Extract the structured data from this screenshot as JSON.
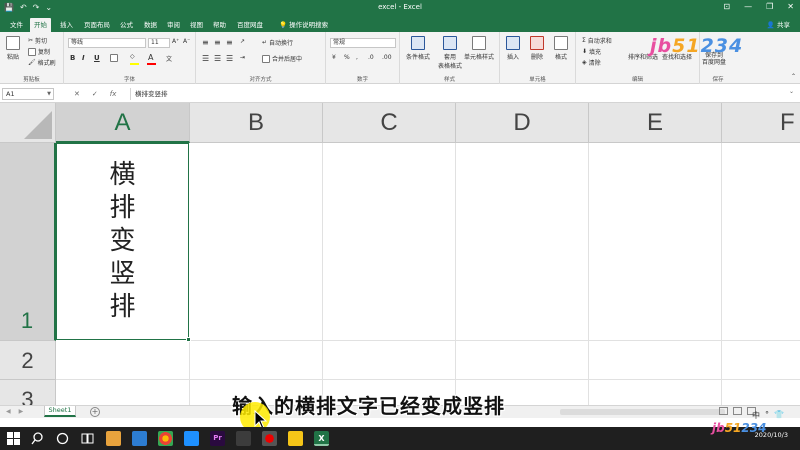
{
  "window": {
    "title": "excel - Excel"
  },
  "quick_access": {
    "save_glyph": "💾",
    "undo_glyph": "↶",
    "redo_glyph": "↷",
    "more_glyph": "⌄"
  },
  "window_controls": {
    "ribbon_opt": "⊡",
    "minimize": "—",
    "restore": "❐",
    "close": "✕"
  },
  "tabs": [
    {
      "label": "文件"
    },
    {
      "label": "开始"
    },
    {
      "label": "插入"
    },
    {
      "label": "页面布局"
    },
    {
      "label": "公式"
    },
    {
      "label": "数据"
    },
    {
      "label": "审阅"
    },
    {
      "label": "视图"
    },
    {
      "label": "帮助"
    },
    {
      "label": "百度网盘"
    },
    {
      "label": "操作说明搜索"
    }
  ],
  "share": "共享",
  "ribbon": {
    "clipboard": {
      "paste": "粘贴",
      "cut": "剪切",
      "copy": "复制",
      "painter": "格式刷",
      "label": "剪贴板"
    },
    "font": {
      "name": "等线",
      "size": "11",
      "bold": "B",
      "italic": "I",
      "underline": "U",
      "label": "字体",
      "grow": "A⁺",
      "shrink": "A⁻"
    },
    "alignment": {
      "wrap": "自动换行",
      "merge": "合并后居中",
      "label": "对齐方式"
    },
    "number": {
      "format": "常规",
      "label": "数字",
      "percent": "%",
      "comma": ","
    },
    "styles": {
      "conditional": "条件格式",
      "table": "套用\n表格格式",
      "cellstyle": "单元格样式",
      "label": "样式"
    },
    "cells": {
      "insert": "插入",
      "delete": "删除",
      "format": "格式",
      "label": "单元格"
    },
    "editing": {
      "autosum": "自动求和",
      "fill": "填充",
      "clear": "清除",
      "sort": "排序和筛选",
      "find": "查找和选择",
      "label": "编辑"
    },
    "save": {
      "label": "保存到\n百度网盘",
      "group": "保存"
    }
  },
  "watermark": {
    "a": "jb",
    "b": "51",
    "c": "234",
    "d": ""
  },
  "formula_bar": {
    "name_box": "A1",
    "cancel": "✕",
    "enter": "✓",
    "fx": "fx",
    "content": "横排变竖排"
  },
  "columns": [
    "A",
    "B",
    "C",
    "D",
    "E",
    "F"
  ],
  "rows": [
    "1",
    "2",
    "3"
  ],
  "cell_a1_chars": [
    "横",
    "排",
    "变",
    "竖",
    "排"
  ],
  "sheet": {
    "name": "Sheet1",
    "add": "+",
    "nav_prev": "◀",
    "nav_next": "▶"
  },
  "subtitle": "输入的横排文字已经变成竖排",
  "ime": {
    "lang": "中",
    "punct": "°",
    "shirt": "👕"
  },
  "taskbar": {
    "time": "",
    "date": "2020/10/3"
  }
}
